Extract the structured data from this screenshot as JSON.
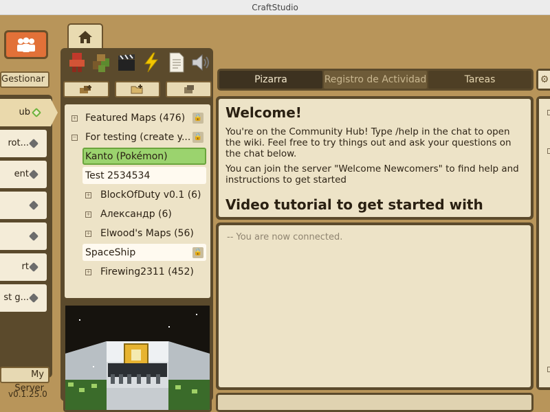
{
  "window": {
    "title": "CraftStudio"
  },
  "sidebar": {
    "manage_label": "Gestionar",
    "servers": [
      {
        "label": "ub",
        "active": true
      },
      {
        "label": "rot...",
        "active": false
      },
      {
        "label": "ent",
        "active": false
      },
      {
        "label": "",
        "active": false
      },
      {
        "label": "",
        "active": false
      },
      {
        "label": "rt",
        "active": false
      },
      {
        "label": "st g...",
        "active": false
      }
    ],
    "my_server_label": "My Server",
    "version": "v0.1.25.0"
  },
  "projects": {
    "tree": [
      {
        "label": "Featured Maps (476)",
        "locked": true,
        "expander": true,
        "indent": 0,
        "style": "plain"
      },
      {
        "label": "For testing (create y...",
        "locked": true,
        "expander": true,
        "indent": 0,
        "style": "plain"
      },
      {
        "label": "Kanto (Pokémon)",
        "locked": false,
        "expander": false,
        "indent": 1,
        "style": "selected"
      },
      {
        "label": "Test 2534534",
        "locked": false,
        "expander": false,
        "indent": 1,
        "style": "boxed"
      },
      {
        "label": "BlockOfDuty v0.1 (6)",
        "locked": false,
        "expander": true,
        "indent": 1,
        "style": "plain"
      },
      {
        "label": "Александр (6)",
        "locked": false,
        "expander": true,
        "indent": 1,
        "style": "plain"
      },
      {
        "label": "Elwood's Maps (56)",
        "locked": false,
        "expander": true,
        "indent": 1,
        "style": "plain"
      },
      {
        "label": "SpaceShip",
        "locked": true,
        "expander": false,
        "indent": 1,
        "style": "boxed"
      },
      {
        "label": "Firewing2311 (452)",
        "locked": false,
        "expander": true,
        "indent": 1,
        "style": "plain"
      }
    ]
  },
  "tabs": [
    {
      "label": "Pizarra",
      "state": "active"
    },
    {
      "label": "Registro de Actividad",
      "state": "inactive"
    },
    {
      "label": "Tareas",
      "state": "normal"
    }
  ],
  "welcome": {
    "heading": "Welcome!",
    "paragraph1": "You're on the Community Hub! Type /help in the chat to open the wiki. Feel free to try things out and ask your questions on the chat below.",
    "paragraph2": "You can join the server \"Welcome Newcomers\" to find help and instructions to get started",
    "subheading": "Video tutorial to get started with"
  },
  "chat": {
    "messages": [
      "-- You are now connected."
    ]
  },
  "colors": {
    "frame": "#b8955a",
    "panel": "#5b4a2c",
    "paper": "#ede3c7",
    "accent_orange": "#e27138",
    "selection_green": "#9bd36e"
  }
}
